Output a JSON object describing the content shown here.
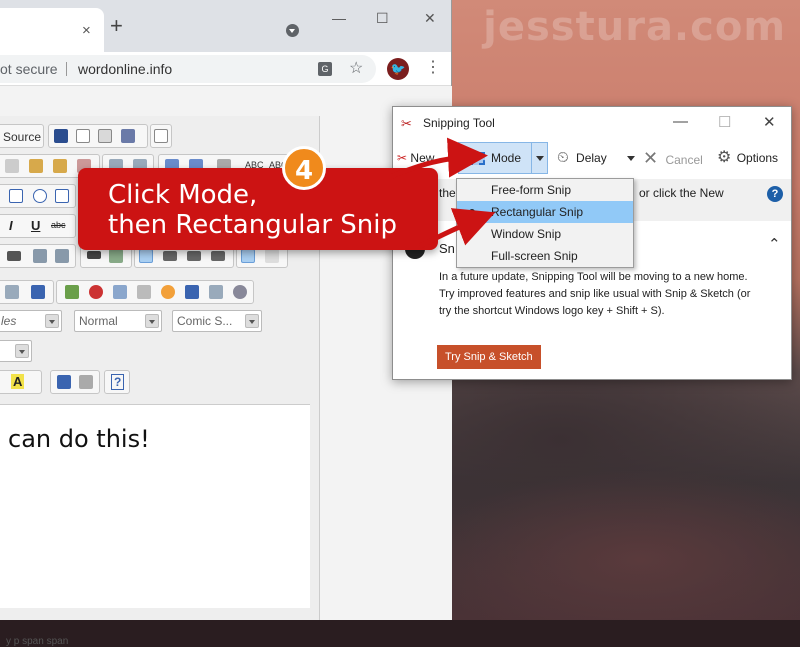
{
  "watermark": "jesstura.com",
  "browser": {
    "tab_close": "×",
    "new_tab": "+",
    "min": "—",
    "max": "☐",
    "close": "✕",
    "security": "ot secure",
    "url": "wordonline.info",
    "translate_icon": "G",
    "star_icon": "☆",
    "avatar_icon": "🐦",
    "menu_icon": "⋮"
  },
  "editor": {
    "source_label": "Source",
    "toolbar_glyphs": {
      "abc": "ABC",
      "italic": "I",
      "underline": "U",
      "strike": "abc",
      "text_color": "A",
      "help": "?"
    },
    "styles_combo": "les",
    "format_combo": "Normal",
    "font_combo": "Comic S...",
    "content": "can do this!",
    "path": "y  p  span  span"
  },
  "snipping_tool": {
    "title": "Snipping Tool",
    "window_min": "—",
    "window_max": "☐",
    "window_close": "✕",
    "new_label": "New",
    "mode_label": "Mode",
    "delay_label": "Delay",
    "cancel_label": "Cancel",
    "options_label": "Options",
    "info_partial_left": "the",
    "info_partial_right": "or click the New",
    "help_icon": "?",
    "collapse_icon": "⌃",
    "message_head": "Sn",
    "message_body": "In a future update, Snipping Tool will be moving to a new home. Try improved features and snip like usual with Snip & Sketch (or try the shortcut Windows logo key + Shift + S).",
    "try_button": "Try Snip & Sketch"
  },
  "mode_menu": {
    "items": [
      {
        "label": "Free-form Snip",
        "selected": false
      },
      {
        "label": "Rectangular Snip",
        "selected": true
      },
      {
        "label": "Window Snip",
        "selected": false
      },
      {
        "label": "Full-screen Snip",
        "selected": false
      }
    ]
  },
  "annotation": {
    "step": "4",
    "line1": "Click Mode,",
    "line2": "then Rectangular Snip",
    "color": "#cc1313",
    "badge_color": "#f08a1c"
  }
}
